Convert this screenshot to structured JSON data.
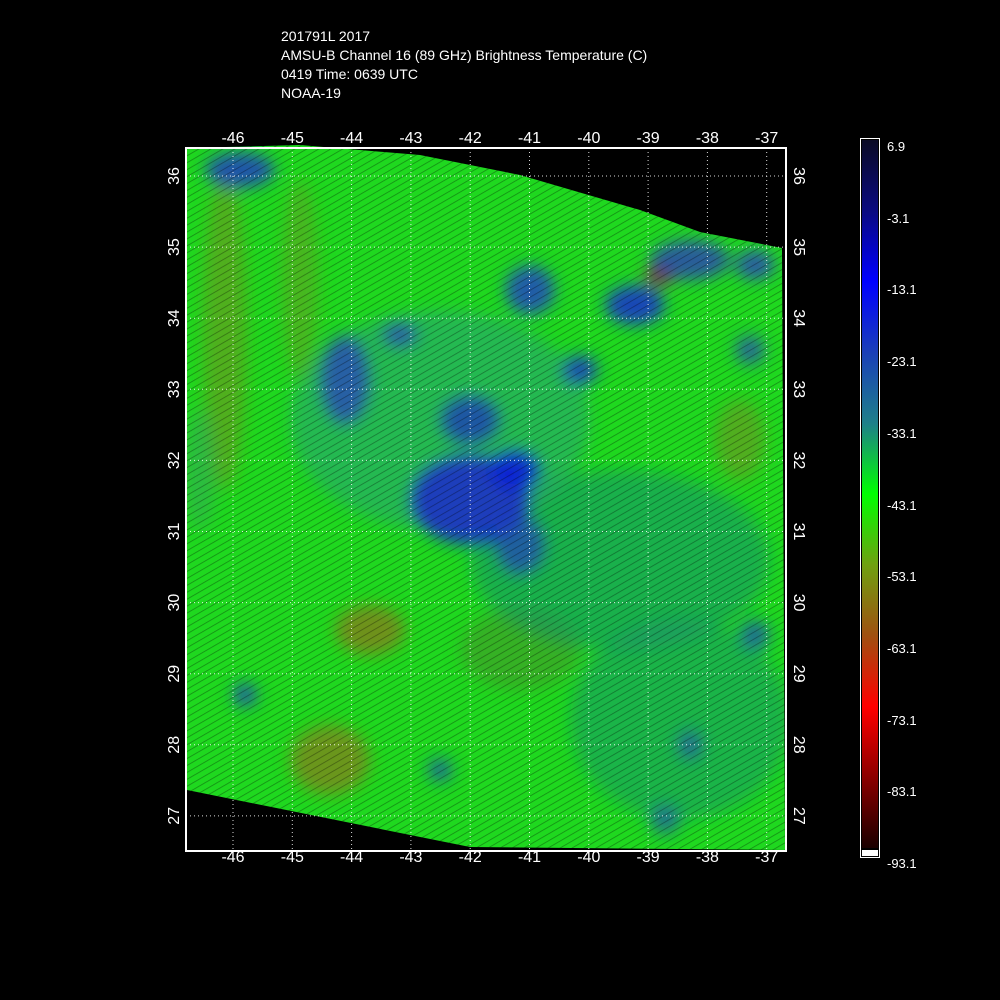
{
  "title": {
    "line1": "201791L 2017",
    "line2": "AMSU-B Channel 16 (89 GHz) Brightness Temperature (C)",
    "line3": "0419 Time: 0639 UTC",
    "line4": "NOAA-19"
  },
  "map": {
    "lon_ticks": [
      "-46",
      "-45",
      "-44",
      "-43",
      "-42",
      "-41",
      "-40",
      "-39",
      "-38",
      "-37"
    ],
    "lat_ticks": [
      "36",
      "35",
      "34",
      "33",
      "32",
      "31",
      "30",
      "29",
      "28",
      "27"
    ],
    "background_color": "#000000",
    "grid_style": "dotted white"
  },
  "colorbar": {
    "labels": [
      "6.9",
      "-3.1",
      "-13.1",
      "-23.1",
      "-33.1",
      "-43.1",
      "-53.1",
      "-63.1",
      "-73.1",
      "-83.1",
      "-93.1"
    ],
    "colors": [
      "#0a0a25",
      "#0a0a80",
      "#0000ff",
      "#1a3fb8",
      "#1e7f8a",
      "#00ff00",
      "#6fa010",
      "#a05010",
      "#ff0000",
      "#8b0000",
      "#1a0000"
    ]
  }
}
